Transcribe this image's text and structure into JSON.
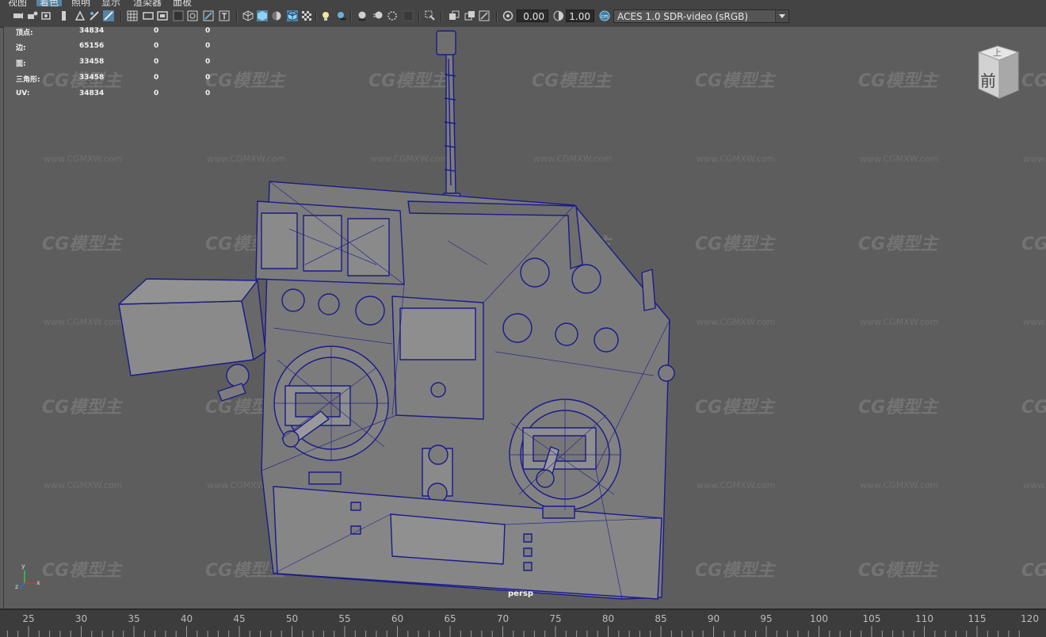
{
  "menu": {
    "items": [
      {
        "label": "视图",
        "active": false
      },
      {
        "label": "着色",
        "active": true
      },
      {
        "label": "照明",
        "active": false
      },
      {
        "label": "显示",
        "active": false
      },
      {
        "label": "渲染器",
        "active": false
      },
      {
        "label": "面板",
        "active": false
      }
    ]
  },
  "toolbar": {
    "exposure_value": "0.00",
    "gamma_value": "1.00",
    "color_space": "ACES 1.0 SDR-video (sRGB)",
    "accent_color": "#4aa3d8"
  },
  "hud": {
    "rows": [
      {
        "label": "顶点:",
        "v1": "34834",
        "v2": "0",
        "v3": "0"
      },
      {
        "label": "边:",
        "v1": "65156",
        "v2": "0",
        "v3": "0"
      },
      {
        "label": "面:",
        "v1": "33458",
        "v2": "0",
        "v3": "0"
      },
      {
        "label": "三角形:",
        "v1": "33458",
        "v2": "0",
        "v3": "0"
      },
      {
        "label": "UV:",
        "v1": "34834",
        "v2": "0",
        "v3": "0"
      }
    ],
    "camera": "persp"
  },
  "viewcube": {
    "top": "上",
    "front": "前"
  },
  "axis": {
    "y": "y",
    "x": "x",
    "z": "z"
  },
  "watermark": {
    "logo": "CG模型主",
    "url": "www.CGMXW.com"
  },
  "timeslider": {
    "ticks": [
      "25",
      "30",
      "35",
      "40",
      "45",
      "50",
      "55",
      "60",
      "65",
      "70",
      "75",
      "80",
      "85",
      "90",
      "95",
      "100",
      "105",
      "110",
      "115",
      "120"
    ]
  },
  "model": {
    "wire_color": "#1a1a8c",
    "shade_color": "#7c7c7c"
  }
}
